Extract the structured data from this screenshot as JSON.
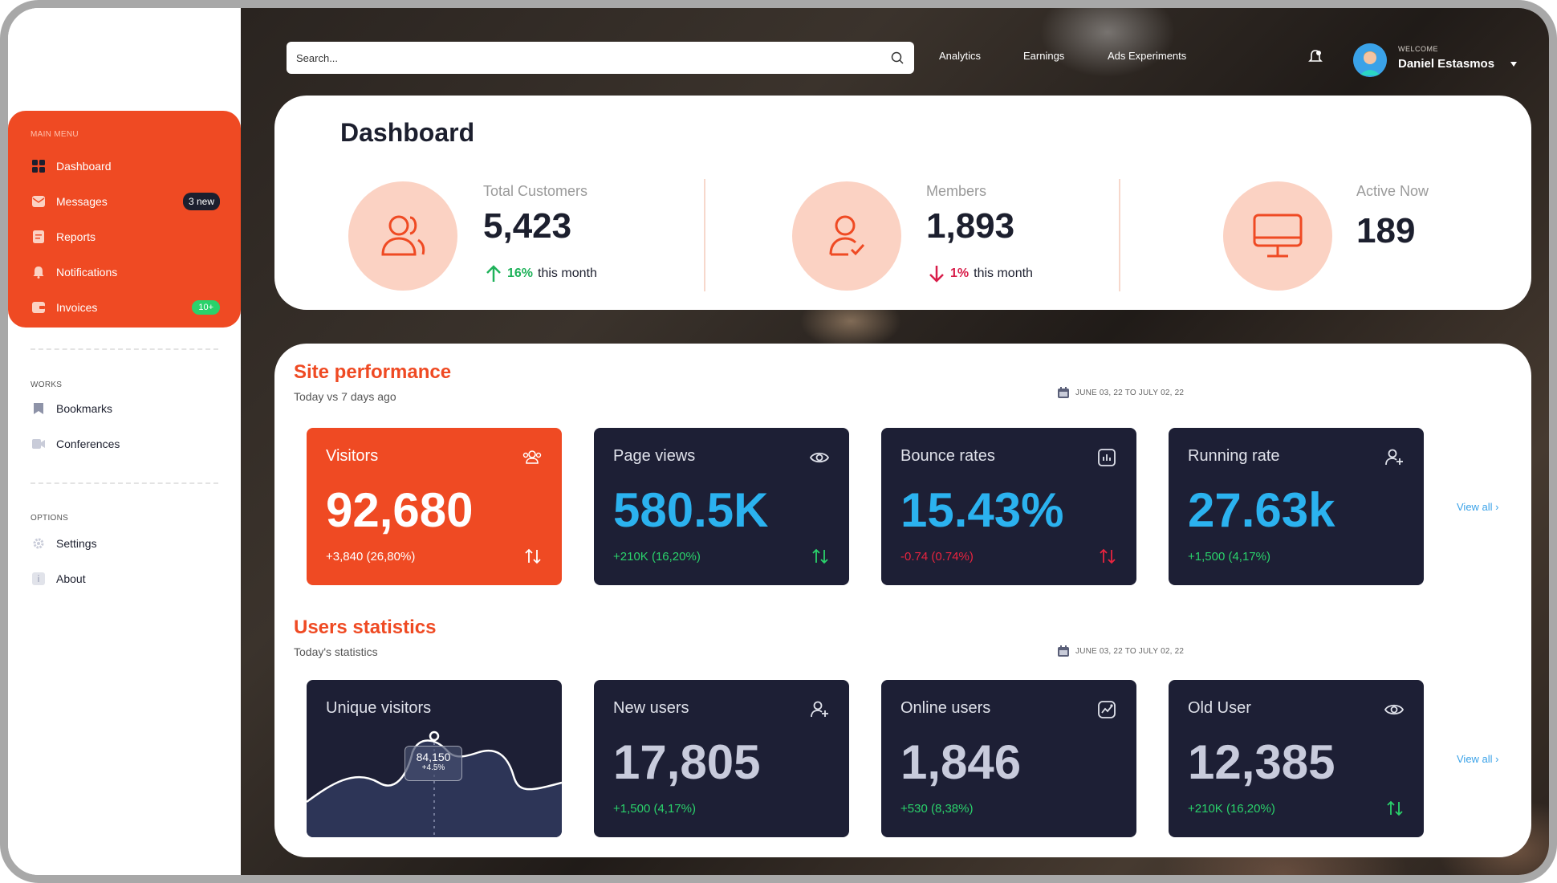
{
  "sidebar": {
    "main_menu_label": "MAIN MENU",
    "main_items": [
      {
        "label": "Dashboard",
        "icon": "grid-icon"
      },
      {
        "label": "Messages",
        "icon": "envelope-icon",
        "badge": "3 new"
      },
      {
        "label": "Reports",
        "icon": "document-icon"
      },
      {
        "label": "Notifications",
        "icon": "bell-icon"
      },
      {
        "label": "Invoices",
        "icon": "wallet-icon",
        "badge": "10+"
      }
    ],
    "works_label": "WORKS",
    "works_items": [
      {
        "label": "Bookmarks",
        "icon": "bookmark-icon"
      },
      {
        "label": "Conferences",
        "icon": "video-icon"
      }
    ],
    "options_label": "OPTIONS",
    "options_items": [
      {
        "label": "Settings",
        "icon": "gear-icon"
      },
      {
        "label": "About",
        "icon": "info-icon"
      }
    ]
  },
  "topbar": {
    "search_placeholder": "Search...",
    "nav": [
      "Analytics",
      "Earnings",
      "Ads Experiments"
    ],
    "welcome": "WELCOME",
    "user_name": "Daniel Estasmos"
  },
  "dashboard": {
    "title": "Dashboard",
    "stats": [
      {
        "label": "Total Customers",
        "value": "5,423",
        "change": "16%",
        "change_suffix": "this month",
        "direction": "up"
      },
      {
        "label": "Members",
        "value": "1,893",
        "change": "1%",
        "change_suffix": "this month",
        "direction": "down"
      },
      {
        "label": "Active Now",
        "value": "189"
      }
    ]
  },
  "site_performance": {
    "title": "Site performance",
    "subtitle": "Today vs 7 days ago",
    "date_range": "JUNE 03, 22 TO JULY 02, 22",
    "view_all": "View all ›",
    "metrics": [
      {
        "label": "Visitors",
        "value": "92,680",
        "delta": "+3,840 (26,80%)",
        "icon": "users-icon"
      },
      {
        "label": "Page views",
        "value": "580.5K",
        "delta": "+210K (16,20%)",
        "icon": "eye-icon"
      },
      {
        "label": "Bounce rates",
        "value": "15.43%",
        "delta": "-0.74 (0.74%)",
        "icon": "bar-chart-icon"
      },
      {
        "label": "Running rate",
        "value": "27.63k",
        "delta": "+1,500 (4,17%)",
        "icon": "user-plus-icon"
      }
    ]
  },
  "users_statistics": {
    "title": "Users statistics",
    "subtitle": "Today's statistics",
    "date_range": "JUNE 03, 22 TO JULY 02, 22",
    "view_all": "View all ›",
    "unique_visitors": {
      "label": "Unique visitors",
      "tooltip_value": "84,150",
      "tooltip_delta": "+4.5%"
    },
    "metrics": [
      {
        "label": "New users",
        "value": "17,805",
        "delta": "+1,500 (4,17%)",
        "icon": "user-plus-icon"
      },
      {
        "label": "Online users",
        "value": "1,846",
        "delta": "+530 (8,38%)",
        "icon": "trend-icon"
      },
      {
        "label": "Old User",
        "value": "12,385",
        "delta": "+210K (16,20%)",
        "icon": "eye-icon"
      }
    ]
  },
  "colors": {
    "accent": "#ef4a23",
    "card_dark": "#1d1f35",
    "value_blue": "#2bb2ef",
    "value_gray": "#c8cbdc",
    "positive": "#2ad26b",
    "negative": "#e8243f",
    "circle_bg": "#fbd2c3"
  }
}
